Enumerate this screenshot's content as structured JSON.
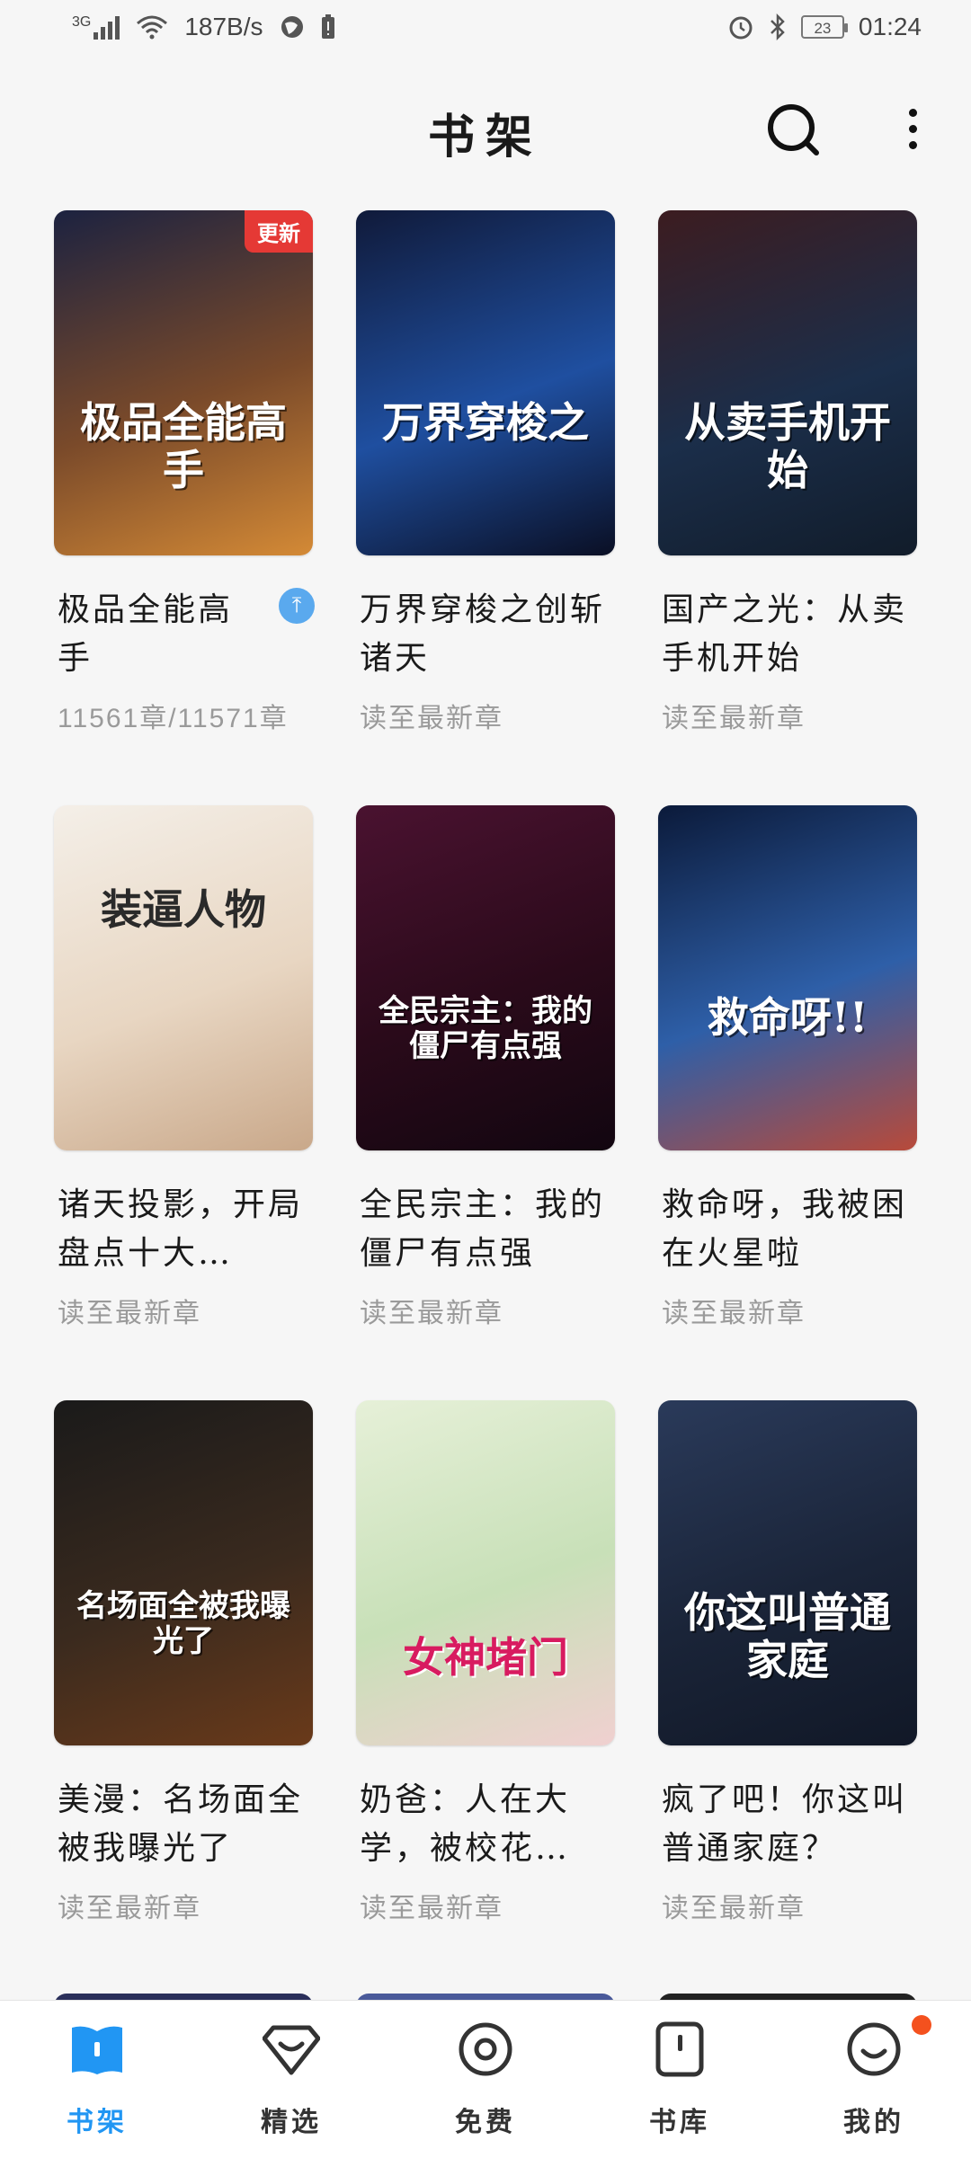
{
  "status_bar": {
    "network_label": "3G",
    "speed": "187B/s",
    "battery": "23",
    "time": "01:24"
  },
  "header": {
    "title": "书架"
  },
  "books": [
    {
      "title": "极品全能高手",
      "progress": "11561章/11571章",
      "badge": "更新",
      "pinned": true,
      "cover_text": "极品全能高手",
      "cover_colors": [
        "#1c2240",
        "#7a4a2a",
        "#d48a36"
      ]
    },
    {
      "title": "万界穿梭之创斩诸天",
      "progress": "读至最新章",
      "cover_text": "万界穿梭之",
      "cover_colors": [
        "#101a3a",
        "#1f4fa0",
        "#0a0f24"
      ]
    },
    {
      "title": "国产之光：从卖手机开始",
      "progress": "读至最新章",
      "cover_text": "从卖手机开始",
      "cover_colors": [
        "#3c1c20",
        "#1b2e4a",
        "#111c2a"
      ]
    },
    {
      "title": "诸天投影，开局盘点十大…",
      "progress": "读至最新章",
      "cover_text": "装逼人物",
      "cover_colors": [
        "#f4efe8",
        "#e8d6c2",
        "#c9a88a"
      ]
    },
    {
      "title": "全民宗主：我的僵尸有点强",
      "progress": "读至最新章",
      "cover_text": "全民宗主：我的僵尸有点强",
      "cover_colors": [
        "#4a1230",
        "#2a0a1a",
        "#120610"
      ]
    },
    {
      "title": "救命呀，我被困在火星啦",
      "progress": "读至最新章",
      "cover_text": "救命呀!!",
      "cover_colors": [
        "#0b1a3a",
        "#2e5fa8",
        "#b84a3a"
      ]
    },
    {
      "title": "美漫：名场面全被我曝光了",
      "progress": "读至最新章",
      "cover_text": "名场面全被我曝光了",
      "cover_colors": [
        "#1a1a1a",
        "#3a2a1e",
        "#6a3a1a"
      ]
    },
    {
      "title": "奶爸：人在大学，被校花…",
      "progress": "读至最新章",
      "cover_text": "女神堵门",
      "cover_colors": [
        "#e6f0d8",
        "#c8e0b8",
        "#f0d0d0"
      ]
    },
    {
      "title": "疯了吧！你这叫普通家庭？",
      "progress": "读至最新章",
      "cover_text": "你这叫普通家庭",
      "cover_colors": [
        "#2a3a5a",
        "#1a2438",
        "#111827"
      ]
    }
  ],
  "bottom_nav": [
    {
      "label": "书架",
      "icon": "bookshelf-icon",
      "active": true
    },
    {
      "label": "精选",
      "icon": "featured-icon"
    },
    {
      "label": "免费",
      "icon": "free-icon"
    },
    {
      "label": "书库",
      "icon": "library-icon"
    },
    {
      "label": "我的",
      "icon": "profile-icon",
      "dot": true
    }
  ],
  "colors": {
    "accent": "#2196f3",
    "badge": "#e53935",
    "muted": "#9a9a9a"
  }
}
